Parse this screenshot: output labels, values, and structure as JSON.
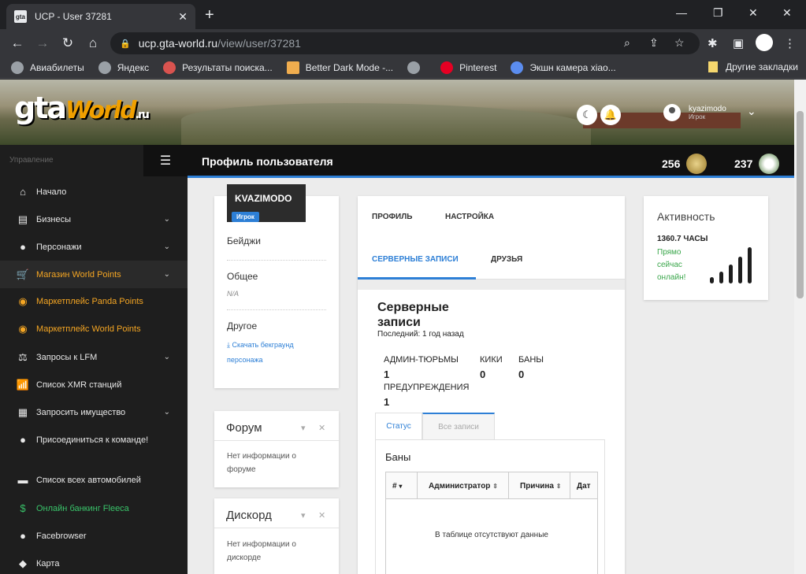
{
  "browser": {
    "tab_title": "UCP - User 37281",
    "tab_favicon_text": "gta",
    "url_host": "ucp.gta-world.ru",
    "url_path": "/view/user/37281",
    "window_controls": [
      "—",
      "❐",
      "✕"
    ],
    "bookmarks": [
      {
        "label": "Авиабилеты",
        "color": "#9aa0a6"
      },
      {
        "label": "Яндекс",
        "color": "#9aa0a6"
      },
      {
        "label": "Результаты поиска...",
        "color": "#d9534f"
      },
      {
        "label": "Better Dark Mode -...",
        "color": "#f0ad4e"
      },
      {
        "label": "",
        "color": "#9aa0a6"
      },
      {
        "label": "Pinterest",
        "color": "#e60023"
      },
      {
        "label": "Экшн камера xiao...",
        "color": "#5b8def"
      }
    ],
    "other_bookmarks": "Другие закладки"
  },
  "header": {
    "logo_main": "gta",
    "logo_world": "World",
    "logo_ru": ".ru",
    "user_name": "kyazimodo",
    "user_role": "Игрок"
  },
  "sidebar": {
    "heading": "Управление",
    "items": [
      {
        "label": "Начало",
        "icon": "home-icon",
        "glyph": "⌂",
        "arrow": ""
      },
      {
        "label": "Бизнесы",
        "icon": "business-icon",
        "glyph": "▤",
        "arrow": "⌄"
      },
      {
        "label": "Персонажи",
        "icon": "person-icon",
        "glyph": "●",
        "arrow": "⌄"
      },
      {
        "label": "Магазин World Points",
        "icon": "cart-icon",
        "glyph": "🛒",
        "arrow": "⌄"
      },
      {
        "label": "Маркетплейс Panda Points",
        "icon": "coins-icon",
        "glyph": "◉",
        "arrow": ""
      },
      {
        "label": "Маркетплейс World Points",
        "icon": "coins-icon",
        "glyph": "◉",
        "arrow": ""
      },
      {
        "label": "Запросы к LFM",
        "icon": "scales-icon",
        "glyph": "⚖",
        "arrow": "⌄"
      },
      {
        "label": "Список XMR станций",
        "icon": "antenna-icon",
        "glyph": "📶",
        "arrow": ""
      },
      {
        "label": "Запросить имущество",
        "icon": "building-icon",
        "glyph": "▦",
        "arrow": "⌄"
      },
      {
        "label": "Присоединиться к команде!",
        "icon": "user-tie-icon",
        "glyph": "●",
        "arrow": ""
      },
      {
        "label": "Список всех автомобилей",
        "icon": "car-icon",
        "glyph": "▬",
        "arrow": ""
      },
      {
        "label": "Онлайн банкинг Fleeca",
        "icon": "money-icon",
        "glyph": "$",
        "arrow": ""
      },
      {
        "label": "Facebrowser",
        "icon": "users-icon",
        "glyph": "●",
        "arrow": ""
      },
      {
        "label": "Карта",
        "icon": "map-pin-icon",
        "glyph": "◆",
        "arrow": ""
      }
    ]
  },
  "topbar": {
    "title": "Профиль пользователя",
    "points_1": "256",
    "points_2": "237"
  },
  "profile": {
    "nickname": "KVAZIMODO",
    "role": "Игрок",
    "badges_label": "Бейджи",
    "general_label": "Общее",
    "general_value": "N/A",
    "other_label": "Другое",
    "download_link": "Скачать бекграунд персонажа"
  },
  "forum": {
    "title": "Форум",
    "body": "Нет информации о форуме"
  },
  "discord": {
    "title": "Дискорд",
    "body": "Нет информации о дискорде"
  },
  "main": {
    "tabs": [
      "ПРОФИЛЬ",
      "НАСТРОЙКА",
      "СЕРВЕРНЫЕ ЗАПИСИ",
      "ДРУЗЬЯ"
    ],
    "records_title_1": "Серверные",
    "records_title_2": "записи",
    "records_last": "Последний: 1 год назад",
    "stats": {
      "jail_label": "АДМИН-ТЮРЬМЫ",
      "jail_value": "1",
      "kicks_label": "КИКИ",
      "kicks_value": "0",
      "bans_label": "БАНЫ",
      "bans_value": "0",
      "warn_label": "ПРЕДУПРЕЖДЕНИЯ",
      "warn_value": "1"
    },
    "inner_tabs": [
      "Статус",
      "Все записи"
    ],
    "bans_title": "Баны",
    "table_headers": [
      "#",
      "Администратор",
      "Причина",
      "Дат"
    ],
    "table_empty": "В таблице отсутствуют данные"
  },
  "activity": {
    "title": "Активность",
    "hours": "1360.7 ЧАСЫ",
    "status": "Прямо сейчас онлайн!"
  }
}
